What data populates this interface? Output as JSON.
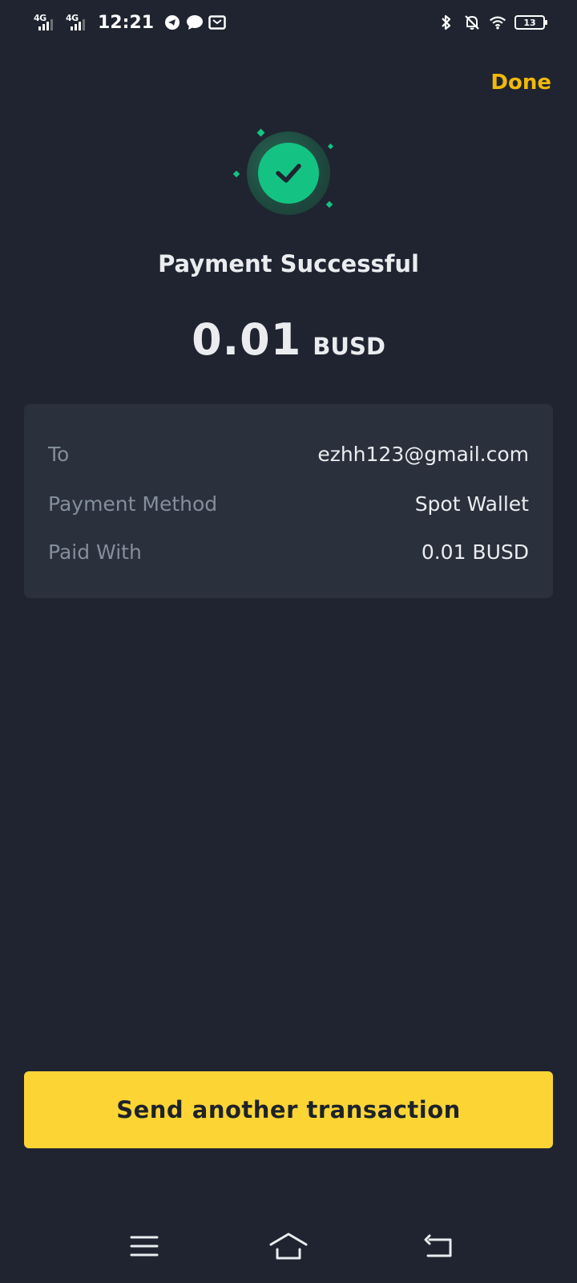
{
  "status_bar": {
    "network_1": "4G",
    "network_2": "4G",
    "time": "12:21",
    "battery_level": "13"
  },
  "header": {
    "done_label": "Done"
  },
  "result": {
    "title": "Payment Successful",
    "amount_value": "0.01",
    "amount_unit": "BUSD",
    "status_color": "#14c383"
  },
  "details": {
    "rows": [
      {
        "label": "To",
        "value": "ezhh123@gmail.com"
      },
      {
        "label": "Payment Method",
        "value": "Spot Wallet"
      },
      {
        "label": "Paid With",
        "value": "0.01 BUSD"
      }
    ]
  },
  "actions": {
    "send_another_label": "Send another transaction",
    "accent_color": "#fcd535"
  },
  "nav": {
    "icons": [
      "menu-icon",
      "home-icon",
      "back-icon"
    ]
  }
}
